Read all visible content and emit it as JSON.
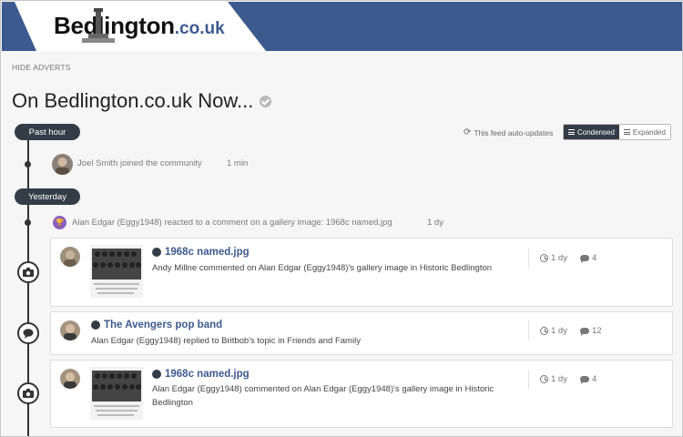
{
  "header": {
    "logo_main": "Bedlington",
    "logo_suffix": ".co.uk"
  },
  "hide_adverts": "HIDE ADVERTS",
  "page_title": "On Bedlington.co.uk Now...",
  "feed": {
    "auto_update_note": "This feed auto-updates",
    "view_condensed": "Condensed",
    "view_expanded": "Expanded"
  },
  "sections": [
    {
      "label": "Past hour"
    },
    {
      "label": "Yesterday"
    }
  ],
  "activities": [
    {
      "text": "Joel Smith joined the community",
      "time": "1 min"
    },
    {
      "text": "Alan Edgar (Eggy1948) reacted to a comment on a gallery image: 1968c named.jpg",
      "time": "1 dy"
    }
  ],
  "cards": [
    {
      "title": "1968c named.jpg",
      "subtitle": "Andy Millne commented on Alan Edgar (Eggy1948)'s gallery image in Historic Bedlington",
      "time": "1 dy",
      "count": "4",
      "icon": "camera-icon"
    },
    {
      "title": "The Avengers pop band",
      "subtitle": "Alan Edgar (Eggy1948) replied to Britbob's topic in Friends and Family",
      "time": "1 dy",
      "count": "12",
      "icon": "speech-bubble-icon"
    },
    {
      "title": "1968c named.jpg",
      "subtitle_line1": "Alan Edgar (Eggy1948) commented on Alan Edgar (Eggy1948)'s gallery image in Historic",
      "subtitle_line2": "Bedlington",
      "time": "1 dy",
      "count": "4",
      "icon": "camera-icon"
    }
  ],
  "colors": {
    "brand_blue": "#3d5a8f",
    "dark_pill": "#333d47",
    "trophy_purple": "#8b5fbf"
  }
}
